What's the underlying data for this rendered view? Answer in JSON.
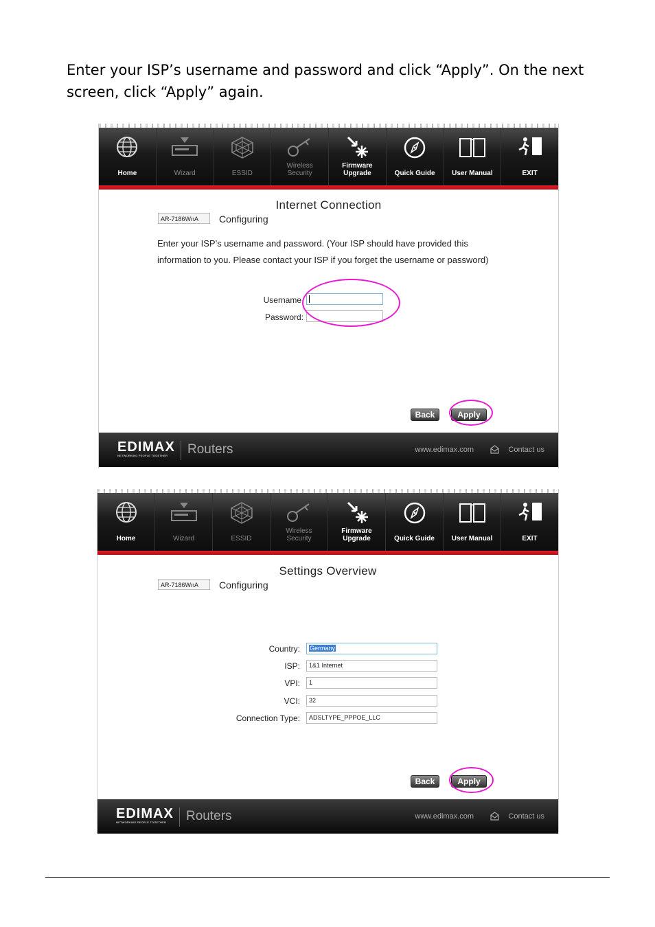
{
  "intro_text": "Enter your ISP’s username and password and click “Apply”. On the next screen, click “Apply” again.",
  "nav_items": [
    {
      "line1": "Home",
      "line2": ""
    },
    {
      "line1": "Wizard",
      "line2": ""
    },
    {
      "line1": "ESSID",
      "line2": ""
    },
    {
      "line1": "Wireless",
      "line2": "Security"
    },
    {
      "line1": "Firmware",
      "line2": "Upgrade"
    },
    {
      "line1": "Quick Guide",
      "line2": ""
    },
    {
      "line1": "User Manual",
      "line2": ""
    },
    {
      "line1": "EXIT",
      "line2": ""
    }
  ],
  "footer": {
    "logo": "EDIMAX",
    "logo_tagline": "NETWORKING PEOPLE TOGETHER",
    "product": "Routers",
    "url": "www.edimax.com",
    "contact": "Contact us"
  },
  "screen1": {
    "title": "Internet Connection",
    "model": "AR-7186WnA",
    "step": "Configuring",
    "description": "Enter your ISP’s username and password. (Your ISP should have provided this information to you. Please contact your ISP if you forget the username or password)",
    "username_label": "Username",
    "username_value": "",
    "password_label": "Password:",
    "password_value": "",
    "back_label": "Back",
    "apply_label": "Apply"
  },
  "screen2": {
    "title": "Settings Overview",
    "model": "AR-7186WnA",
    "step": "Configuring",
    "fields": [
      {
        "label": "Country:",
        "value": "Germany"
      },
      {
        "label": "ISP:",
        "value": "1&1 Internet"
      },
      {
        "label": "VPI:",
        "value": "1"
      },
      {
        "label": "VCI:",
        "value": "32"
      },
      {
        "label": "Connection Type:",
        "value": "ADSLTYPE_PPPOE_LLC"
      }
    ],
    "back_label": "Back",
    "apply_label": "Apply"
  },
  "colors": {
    "accent_red": "#e8202a",
    "highlight_magenta": "#e81ad0",
    "nav_dark": "#1a1a1a"
  }
}
